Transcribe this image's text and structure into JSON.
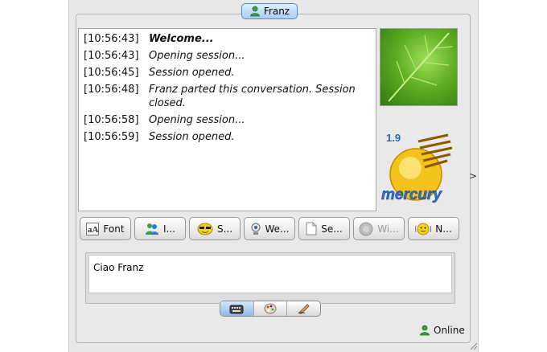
{
  "contact": {
    "name": "Franz"
  },
  "chat": {
    "lines": [
      {
        "time": "[10:56:43]",
        "text": "Welcome...",
        "bold": true
      },
      {
        "time": "[10:56:43]",
        "text": "Opening session..."
      },
      {
        "time": "[10:56:45]",
        "text": "Session opened."
      },
      {
        "time": "[10:56:48]",
        "text": "Franz parted this conversation. Session closed."
      },
      {
        "time": "[10:56:58]",
        "text": "Opening session..."
      },
      {
        "time": "[10:56:59]",
        "text": "Session opened."
      }
    ]
  },
  "logo": {
    "version": "1.9",
    "name": "mercury"
  },
  "side_arrow": ">",
  "toolbar": {
    "font": {
      "icon": "font-icon",
      "label": "Font"
    },
    "invite": {
      "icon": "invite-contacts-icon",
      "label": "I..."
    },
    "smileys": {
      "icon": "smiley-icon",
      "label": "S..."
    },
    "webcam": {
      "icon": "webcam-icon",
      "label": "We..."
    },
    "send_file": {
      "icon": "send-file-icon",
      "label": "Se..."
    },
    "winks": {
      "icon": "winks-icon",
      "label": "Wi..."
    },
    "nudge": {
      "icon": "nudge-icon",
      "label": "N..."
    }
  },
  "input": {
    "value": "Ciao Franz"
  },
  "modes": [
    {
      "icon": "keyboard-icon",
      "active": true
    },
    {
      "icon": "palette-icon"
    },
    {
      "icon": "handwriting-icon"
    }
  ],
  "status": {
    "label": "Online",
    "color": "#2e8b3d"
  },
  "colors": {
    "tab_blue": "#a9cdf3",
    "panel": "#e9e9e9"
  }
}
